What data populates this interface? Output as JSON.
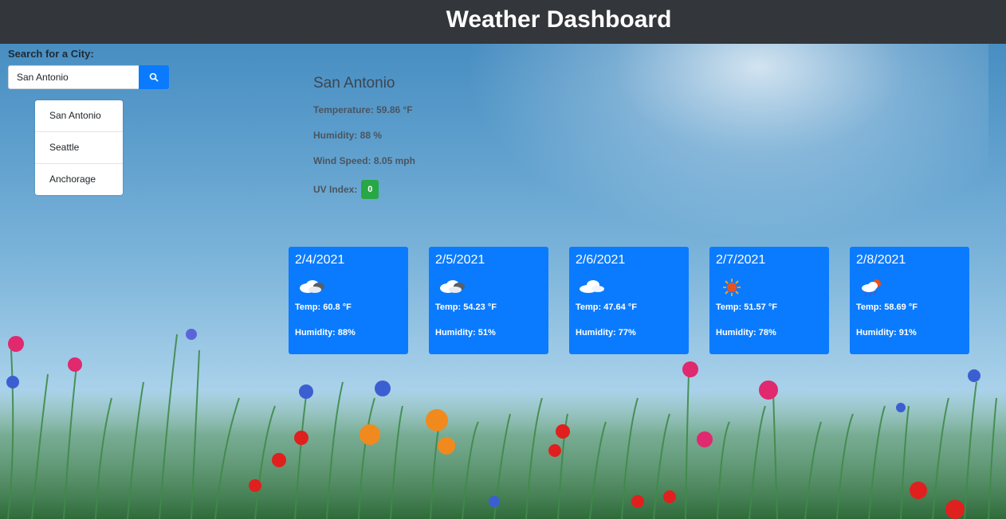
{
  "header": {
    "title": "Weather Dashboard"
  },
  "search": {
    "label": "Search for a City:",
    "value": "San Antonio",
    "button_icon": "search-icon"
  },
  "history": [
    "San Antonio",
    "Seattle",
    "Anchorage"
  ],
  "current": {
    "city": "San Antonio",
    "temperature": "Temperature: 59.86 °F",
    "humidity": "Humidity: 88 %",
    "wind": "Wind Speed: 8.05 mph",
    "uv_label": "UV Index:",
    "uv_value": "0",
    "uv_color": "#28a745"
  },
  "forecast": [
    {
      "date": "2/4/2021",
      "icon": "cloud-rain-icon",
      "temp": "Temp: 60.8 °F",
      "humidity": "Humidity: 88%"
    },
    {
      "date": "2/5/2021",
      "icon": "cloud-rain-icon",
      "temp": "Temp: 54.23 °F",
      "humidity": "Humidity: 51%"
    },
    {
      "date": "2/6/2021",
      "icon": "cloud-icon",
      "temp": "Temp: 47.64 °F",
      "humidity": "Humidity: 77%"
    },
    {
      "date": "2/7/2021",
      "icon": "sun-icon",
      "temp": "Temp: 51.57 °F",
      "humidity": "Humidity: 78%"
    },
    {
      "date": "2/8/2021",
      "icon": "sun-rain-icon",
      "temp": "Temp: 58.69 °F",
      "humidity": "Humidity: 91%"
    }
  ],
  "colors": {
    "header_bg": "#33363a",
    "accent": "#0a7bff",
    "uv_good": "#28a745"
  }
}
